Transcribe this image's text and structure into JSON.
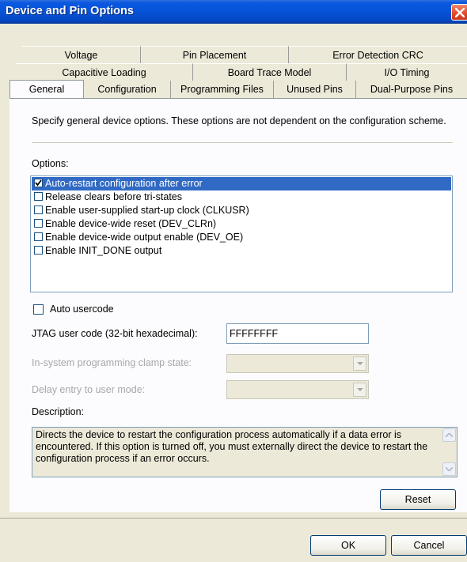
{
  "window": {
    "title": "Device and Pin Options"
  },
  "tabs": {
    "row1": [
      "Voltage",
      "Pin Placement",
      "Error Detection CRC"
    ],
    "row2": [
      "Capacitive Loading",
      "Board Trace Model",
      "I/O Timing"
    ],
    "row3": [
      "General",
      "Configuration",
      "Programming Files",
      "Unused Pins",
      "Dual-Purpose Pins"
    ]
  },
  "general": {
    "intro": "Specify general device options. These options are not dependent on the configuration scheme.",
    "options_label": "Options:",
    "options": [
      {
        "label": "Auto-restart configuration after error",
        "checked": true,
        "selected": true
      },
      {
        "label": "Release clears before tri-states",
        "checked": false,
        "selected": false
      },
      {
        "label": "Enable user-supplied start-up clock (CLKUSR)",
        "checked": false,
        "selected": false
      },
      {
        "label": "Enable device-wide reset (DEV_CLRn)",
        "checked": false,
        "selected": false
      },
      {
        "label": "Enable device-wide output enable (DEV_OE)",
        "checked": false,
        "selected": false
      },
      {
        "label": "Enable INIT_DONE output",
        "checked": false,
        "selected": false
      }
    ],
    "auto_usercode_label": "Auto usercode",
    "jtag_label": "JTAG user code (32-bit hexadecimal):",
    "jtag_value": "FFFFFFFF",
    "isp_label": "In-system programming clamp state:",
    "isp_value": "",
    "delay_label": "Delay entry to user mode:",
    "delay_value": "",
    "description_label": "Description:",
    "description": "Directs the device to restart the configuration process automatically if a data error is encountered. If this option is turned off, you must externally direct the device to restart the configuration process if an error occurs.",
    "reset_label": "Reset"
  },
  "footer": {
    "ok_label": "OK",
    "cancel_label": "Cancel"
  },
  "colors": {
    "title_blue": "#0653d8",
    "selection": "#316ac5",
    "face": "#ece9d8",
    "close_red": "#e0492a"
  }
}
